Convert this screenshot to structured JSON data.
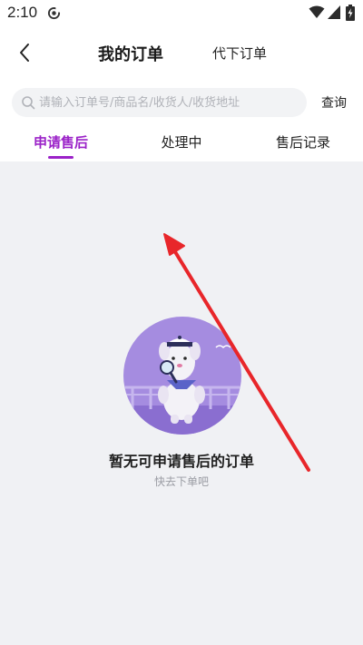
{
  "status_bar": {
    "time": "2:10",
    "app_icon": "circle-arrow-icon",
    "icons": [
      "wifi-icon",
      "signal-icon",
      "battery-charging-icon"
    ]
  },
  "nav": {
    "back_icon": "chevron-left-icon",
    "title": "我的订单",
    "proxy_orders": "代下订单"
  },
  "search": {
    "placeholder": "请输入订单号/商品名/收货人/收货地址",
    "value": "",
    "button_label": "查询"
  },
  "tabs": [
    {
      "label": "申请售后",
      "active": true
    },
    {
      "label": "处理中",
      "active": false
    },
    {
      "label": "售后记录",
      "active": false
    }
  ],
  "empty_state": {
    "illustration": "sailor-dog-mascot-with-magnifier",
    "title": "暂无可申请售后的订单",
    "subtitle": "快去下单吧"
  },
  "annotation": {
    "type": "red-arrow",
    "color": "#e8262a"
  },
  "colors": {
    "accent": "#9b22c8",
    "background": "#f0f1f4",
    "illustration_circle": "#a58ce0"
  }
}
